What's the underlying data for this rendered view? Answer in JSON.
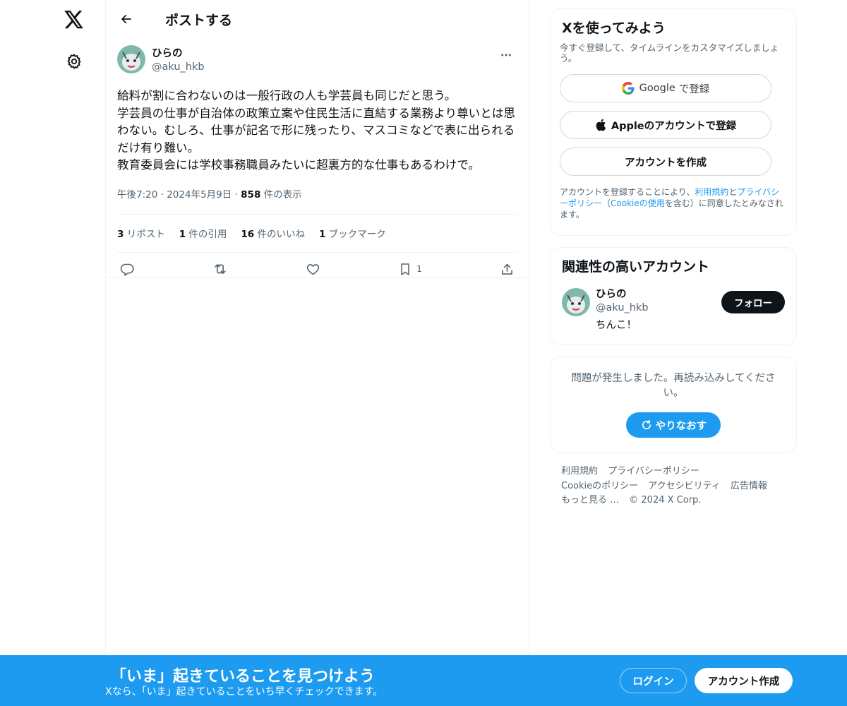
{
  "nav": {
    "logo_icon": "x-logo-icon",
    "settings_icon": "gear-icon"
  },
  "header": {
    "back_icon": "arrow-left-icon",
    "title": "ポストする"
  },
  "tweet": {
    "author": {
      "display_name": "ひらの",
      "handle": "@aku_hkb",
      "avatar_icon": "avatar-image"
    },
    "text": "給料が割に合わないのは一般行政の人も学芸員も同じだと思う。\n学芸員の仕事が自治体の政策立案や住民生活に直結する業務より尊いとは思わない。むしろ、仕事が記名で形に残ったり、マスコミなどで表に出られるだけ有り難い。\n教育委員会には学校事務職員みたいに超裏方的な仕事もあるわけで。",
    "time": "午後7:20",
    "sep1": "·",
    "date": "2024年5月9日",
    "sep2": "·",
    "views_count": "858",
    "views_label": "件の表示",
    "stats": [
      {
        "count": "3",
        "label": "リポスト"
      },
      {
        "count": "1",
        "label": "件の引用"
      },
      {
        "count": "16",
        "label": "件のいいね"
      },
      {
        "count": "1",
        "label": "ブックマーク"
      }
    ],
    "actions": {
      "reply_icon": "reply-icon",
      "repost_icon": "repost-icon",
      "like_icon": "heart-icon",
      "bookmark_icon": "bookmark-icon",
      "bookmark_count": "1",
      "share_icon": "share-icon"
    }
  },
  "signup_card": {
    "title": "Xを使ってみよう",
    "subtitle": "今すぐ登録して、タイムラインをカスタマイズしましょう。",
    "google_brand": "Google",
    "google_label": "で登録",
    "apple_label": "Appleのアカウントで登録",
    "create_label": "アカウントを作成",
    "legal_prefix": "アカウントを登録することにより、",
    "legal_terms": "利用規約",
    "legal_and": "と",
    "legal_privacy": "プライバシーポリシー",
    "legal_paren_open": "（",
    "legal_cookie": "Cookieの使用",
    "legal_suffix": "を含む）に同意したとみなされます。"
  },
  "related_card": {
    "title": "関連性の高いアカウント",
    "display_name": "ひらの",
    "handle": "@aku_hkb",
    "bio": "ちんこ！",
    "follow_label": "フォロー"
  },
  "error_card": {
    "message": "問題が発生しました。再読み込みしてください。",
    "retry_label": "やりなおす"
  },
  "footer": {
    "links_row1": [
      "利用規約",
      "プライバシーポリシー"
    ],
    "links_row2": [
      "Cookieのポリシー",
      "アクセシビリティ",
      "広告情報"
    ],
    "more": "もっと見る …",
    "copyright": "© 2024 X Corp."
  },
  "banner": {
    "title": "「いま」起きていることを見つけよう",
    "subtitle": "Xなら、「いま」起きていることをいち早くチェックできます。",
    "login_label": "ログイン",
    "signup_label": "アカウント作成"
  },
  "colors": {
    "accent": "#1d9bf0",
    "text_primary": "#0f1419",
    "text_secondary": "#536471",
    "border": "#eff3f4"
  }
}
